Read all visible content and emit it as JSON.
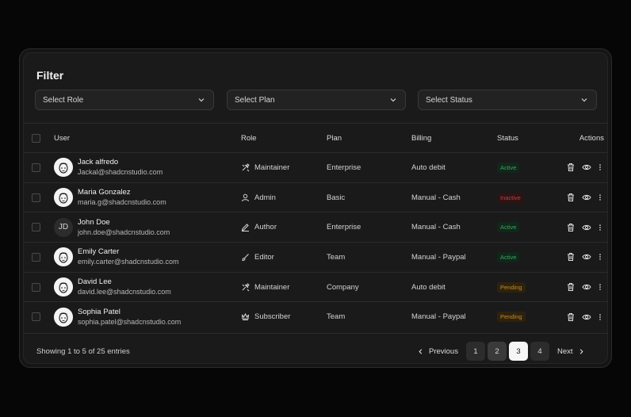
{
  "filter": {
    "title": "Filter",
    "selects": [
      {
        "value": "Select Role"
      },
      {
        "value": "Select Plan"
      },
      {
        "value": "Select Status"
      }
    ]
  },
  "table": {
    "headers": {
      "user": "User",
      "role": "Role",
      "plan": "Plan",
      "billing": "Billing",
      "status": "Status",
      "actions": "Actions"
    },
    "rows": [
      {
        "name": "Jack alfredo",
        "email": "Jackal@shadcnstudio.com",
        "role": "Maintainer",
        "role_icon": "tools-icon",
        "plan": "Enterprise",
        "billing": "Auto debit",
        "status": "Active",
        "status_kind": "active"
      },
      {
        "name": "Maria Gonzalez",
        "email": "maria.g@shadcnstudio.com",
        "role": "Admin",
        "role_icon": "user-icon",
        "plan": "Basic",
        "billing": "Manual - Cash",
        "status": "Inactive",
        "status_kind": "inactive"
      },
      {
        "name": "John Doe",
        "email": "john.doe@shadcnstudio.com",
        "initials": "JD",
        "role": "Author",
        "role_icon": "pencil-icon",
        "plan": "Enterprise",
        "billing": "Manual - Cash",
        "status": "Active",
        "status_kind": "active"
      },
      {
        "name": "Emily Carter",
        "email": "emily.carter@shadcnstudio.com",
        "role": "Editor",
        "role_icon": "brush-icon",
        "plan": "Team",
        "billing": "Manual - Paypal",
        "status": "Active",
        "status_kind": "active"
      },
      {
        "name": "David Lee",
        "email": "david.lee@shadcnstudio.com",
        "role": "Maintainer",
        "role_icon": "tools-icon",
        "plan": "Company",
        "billing": "Auto debit",
        "status": "Pending",
        "status_kind": "pending"
      },
      {
        "name": "Sophia Patel",
        "email": "sophia.patel@shadcnstudio.com",
        "role": "Subscriber",
        "role_icon": "crown-icon",
        "plan": "Team",
        "billing": "Manual - Paypal",
        "status": "Pending",
        "status_kind": "pending"
      }
    ]
  },
  "footer": {
    "showing": "Showing 1 to 5 of 25 entries",
    "previous": "Previous",
    "next": "Next",
    "pages": [
      "1",
      "2",
      "3",
      "4"
    ],
    "current_page": "3"
  },
  "colors": {
    "background": "#060606",
    "card": "#1a1a1a",
    "active": "#3fa35f",
    "inactive": "#c0403f",
    "pending": "#c08a2a"
  }
}
